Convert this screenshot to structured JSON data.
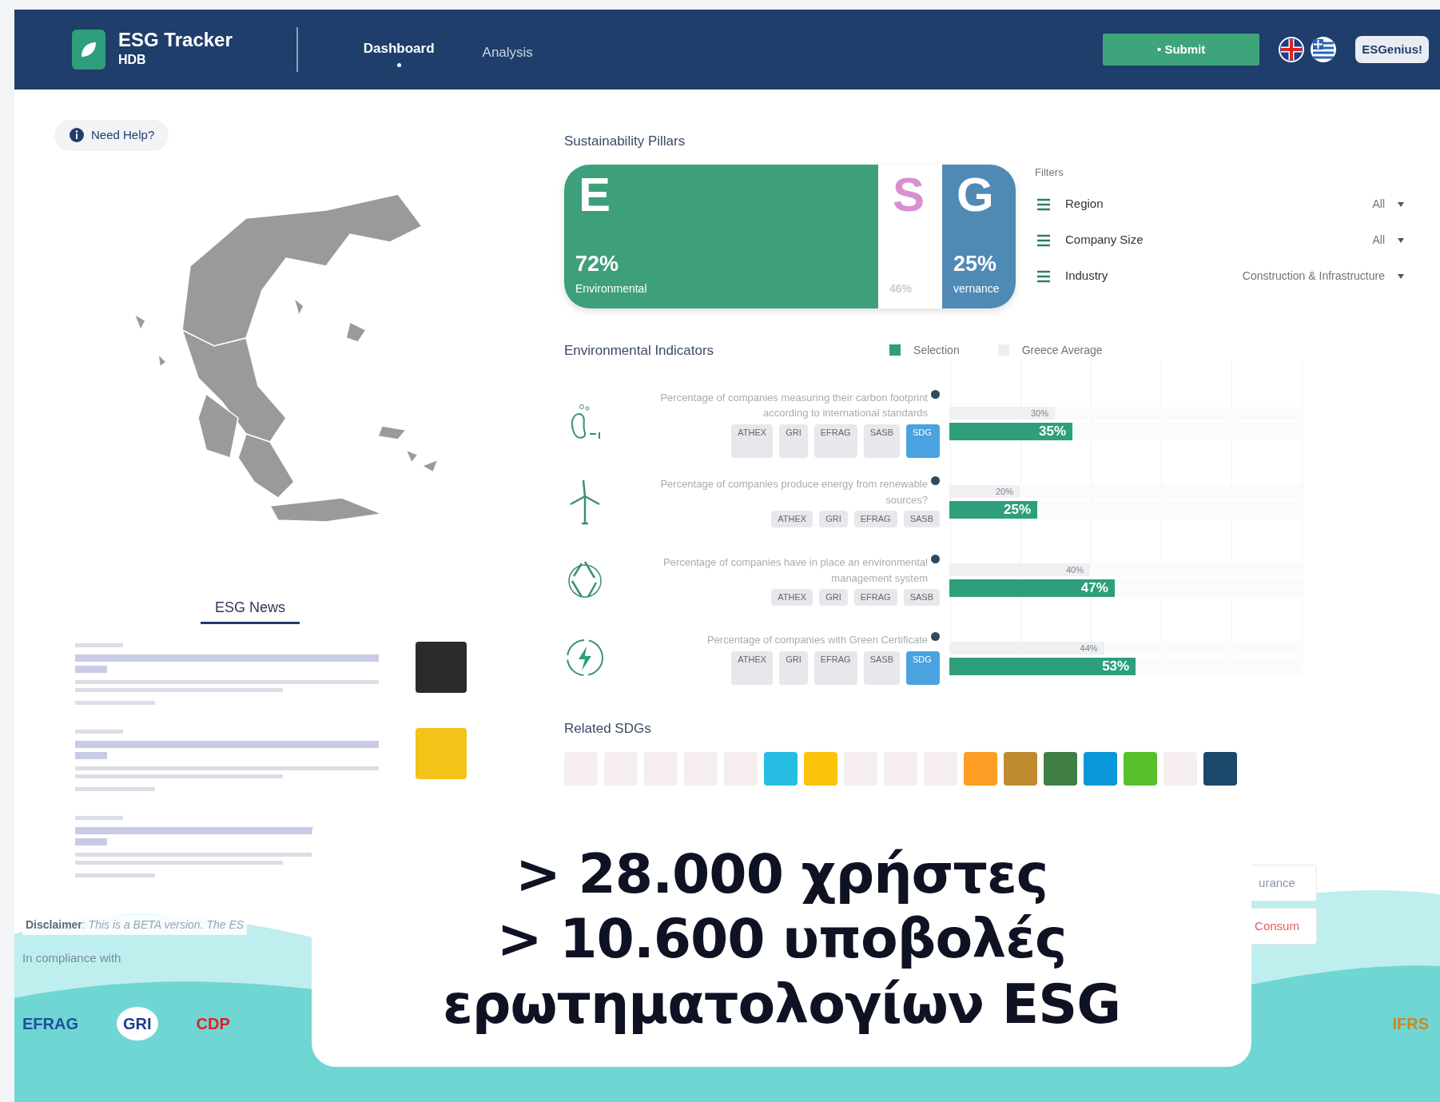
{
  "header": {
    "title": "ESG Tracker",
    "subtitle": "HDB",
    "nav": [
      {
        "label": "Dashboard",
        "selected": true
      },
      {
        "label": "Analysis",
        "selected": false
      }
    ],
    "submit": "• Submit",
    "brand": "ESGenius!"
  },
  "help": {
    "label": "Need Help?"
  },
  "news": {
    "title": "ESG News",
    "items": [
      {
        "thumbnail": true
      },
      {
        "thumbnail": true
      },
      {
        "thumbnail": false
      }
    ]
  },
  "disclaimer": {
    "label": "Disclaimer",
    "text": ": This is a BETA version. The ES"
  },
  "compliance": {
    "title": "In compliance with",
    "logos": [
      "EFRAG",
      "GRI",
      "CDP",
      "IFRS"
    ]
  },
  "pillars": {
    "title": "Sustainability Pillars",
    "items": [
      {
        "letter": "E",
        "value": "72%",
        "label": "Environmental",
        "expanded": true,
        "color": "#3e9f7b"
      },
      {
        "letter": "S",
        "value": "46%",
        "expanded": false,
        "color": "#d98fd0"
      },
      {
        "letter": "G",
        "value": "25%",
        "label": "vernance",
        "expanded": false,
        "color": "#4f8ab5"
      }
    ]
  },
  "filters": {
    "title": "Filters",
    "items": [
      {
        "label": "Region",
        "value": "All"
      },
      {
        "label": "Company Size",
        "value": "All"
      },
      {
        "label": "Industry",
        "value": "Construction & Infrastructure"
      }
    ]
  },
  "indicators": {
    "title": "Environmental Indicators",
    "legend": [
      {
        "label": "Selection",
        "color": "#2e9e7c"
      },
      {
        "label": "Greece Average",
        "color": "#eceef0"
      }
    ],
    "rows": [
      {
        "text": "Percentage of companies measuring their carbon footprint according to international standards",
        "level": 0.35,
        "reading": "35%",
        "average": {
          "level": 0.3,
          "reading": "30%"
        },
        "tags": [
          "ATHEX",
          "GRI",
          "EFRAG",
          "SASB",
          "SDG"
        ]
      },
      {
        "text": "Percentage of companies produce energy from renewable sources?",
        "level": 0.25,
        "reading": "25%",
        "average": {
          "level": 0.2,
          "reading": "20%"
        },
        "tags": [
          "ATHEX",
          "GRI",
          "EFRAG",
          "SASB"
        ]
      },
      {
        "text": "Percentage of companies have in place an environmental management system",
        "level": 0.47,
        "reading": "47%",
        "average": {
          "level": 0.4,
          "reading": "40%"
        },
        "tags": [
          "ATHEX",
          "GRI",
          "EFRAG",
          "SASB"
        ]
      },
      {
        "text": "Percentage of companies with Green Certificate",
        "level": 0.53,
        "reading": "53%",
        "average": {
          "level": 0.44,
          "reading": "44%"
        },
        "tags": [
          "ATHEX",
          "GRI",
          "EFRAG",
          "SASB",
          "SDG"
        ]
      }
    ]
  },
  "sdgs": {
    "title": "Related SDGs",
    "items": [
      {
        "selected": false
      },
      {
        "selected": false
      },
      {
        "selected": false
      },
      {
        "selected": false
      },
      {
        "selected": false
      },
      {
        "selected": true,
        "color": "#26bde2"
      },
      {
        "selected": true,
        "color": "#fcc30b"
      },
      {
        "selected": false
      },
      {
        "selected": false
      },
      {
        "selected": false
      },
      {
        "selected": true,
        "color": "#fd9d24"
      },
      {
        "selected": true,
        "color": "#bf8b2e"
      },
      {
        "selected": true,
        "color": "#3f7e44"
      },
      {
        "selected": true,
        "color": "#0a97d9"
      },
      {
        "selected": true,
        "color": "#56c02b"
      },
      {
        "selected": false
      },
      {
        "selected": true,
        "color": "#19486a"
      }
    ]
  },
  "side_buttons": [
    {
      "label": "urance",
      "kind": "plain"
    },
    {
      "label": "Consum",
      "kind": "danger"
    }
  ],
  "overlay": {
    "lines": [
      "> 28.000 χρήστες",
      "> 10.600 υποβολές",
      "ερωτηματολογίων ESG"
    ]
  }
}
